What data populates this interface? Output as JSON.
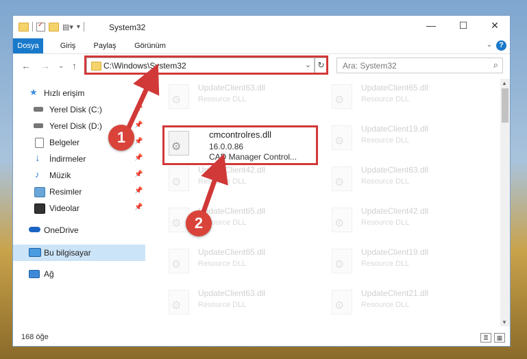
{
  "window": {
    "title": "System32",
    "controls": {
      "minimize": "—",
      "maximize": "☐",
      "close": "✕"
    }
  },
  "ribbon": {
    "tabs": [
      "Dosya",
      "Giriş",
      "Paylaş",
      "Görünüm"
    ],
    "active_tab": "Dosya",
    "help": "?",
    "collapse": "⌄"
  },
  "nav": {
    "back": "←",
    "forward": "→",
    "recent": "⌄",
    "up": "↑",
    "address": "C:\\Windows\\System32",
    "address_dropdown": "⌄",
    "refresh": "↻",
    "search_placeholder": "Ara: System32",
    "search_icon": "⌕"
  },
  "sidebar": {
    "items": [
      {
        "label": "Hızlı erişim",
        "icon": "star-icon",
        "pinned": false
      },
      {
        "label": "Yerel Disk (C:)",
        "icon": "drive-icon",
        "pinned": true
      },
      {
        "label": "Yerel Disk (D:)",
        "icon": "drive-icon",
        "pinned": true
      },
      {
        "label": "Belgeler",
        "icon": "documents-icon",
        "pinned": true
      },
      {
        "label": "İndirmeler",
        "icon": "download-icon",
        "pinned": true
      },
      {
        "label": "Müzik",
        "icon": "music-icon",
        "pinned": true
      },
      {
        "label": "Resimler",
        "icon": "pictures-icon",
        "pinned": true
      },
      {
        "label": "Videolar",
        "icon": "videos-icon",
        "pinned": true
      },
      {
        "label": "OneDrive",
        "icon": "cloud-icon",
        "pinned": false
      },
      {
        "label": "Bu bilgisayar",
        "icon": "computer-icon",
        "pinned": false,
        "selected": true
      },
      {
        "label": "Ağ",
        "icon": "network-icon",
        "pinned": false
      }
    ],
    "pin_glyph": "📌"
  },
  "files": {
    "left": [
      {
        "name": "UpdateClient63.dll",
        "sub": "Resource DLL"
      },
      {
        "name": "cmcontrolres.dll",
        "sub": "16.0.0.86",
        "sub2": "CAD Manager Control..."
      },
      {
        "name": "UpdateClient42.dll",
        "sub": "Resource DLL"
      },
      {
        "name": "UpdateClient65.dll",
        "sub": "Resource DLL"
      },
      {
        "name": "UpdateClient65.dll",
        "sub": "Resource DLL"
      },
      {
        "name": "UpdateClient63.dll",
        "sub": "Resource DLL"
      }
    ],
    "right": [
      {
        "name": "UpdateClient65.dll",
        "sub": "Resource DLL"
      },
      {
        "name": "UpdateClient19.dll",
        "sub": "Resource DLL"
      },
      {
        "name": "UpdateClient63.dll",
        "sub": "Resource DLL"
      },
      {
        "name": "UpdateClient42.dll",
        "sub": "Resource DLL"
      },
      {
        "name": "UpdateClient19.dll",
        "sub": "Resource DLL"
      },
      {
        "name": "UpdateClient21.dll",
        "sub": "Resource DLL"
      }
    ]
  },
  "status": {
    "count": "168 öğe"
  },
  "annotations": {
    "step1": "1",
    "step2": "2",
    "color": "#d13838"
  }
}
